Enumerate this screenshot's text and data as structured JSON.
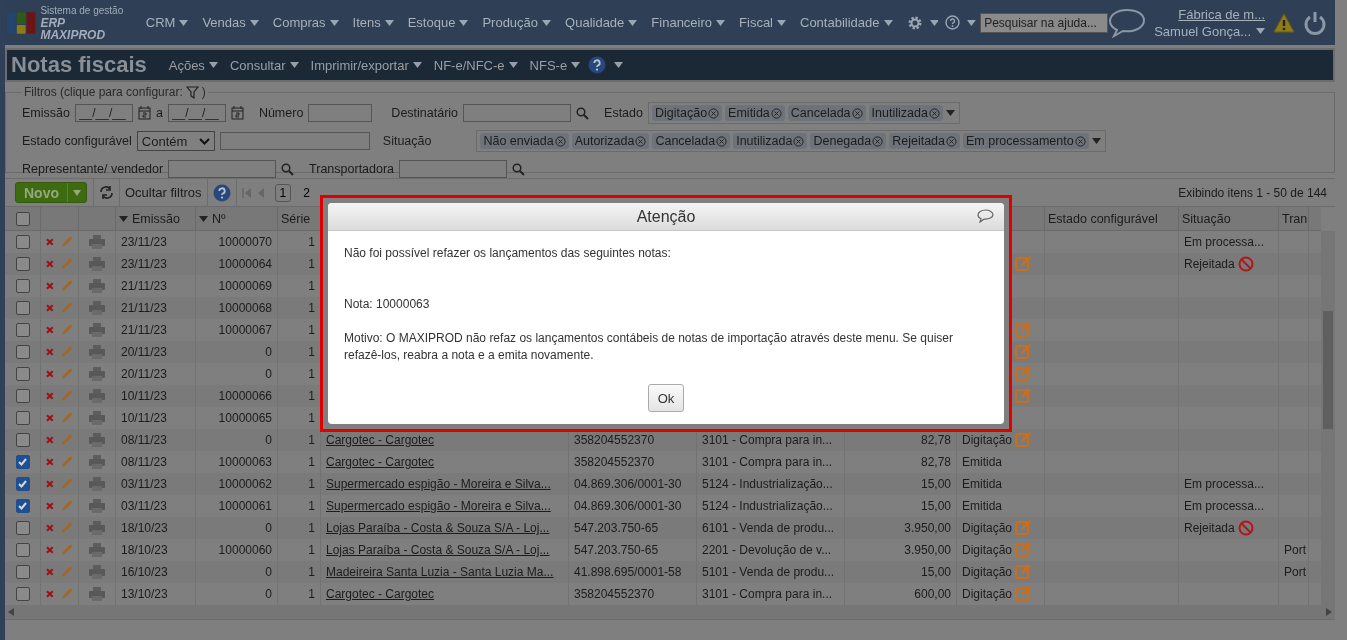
{
  "header": {
    "logo_line1": "Sistema de gestão",
    "logo_line2": "ERP MAXIPROD",
    "menu": [
      "CRM",
      "Vendas",
      "Compras",
      "Itens",
      "Estoque",
      "Produção",
      "Qualidade",
      "Financeiro",
      "Fiscal",
      "Contabilidade"
    ],
    "help_search": {
      "placeholder": "Pesquisar na ajuda..."
    },
    "company": "Fábrica de m...",
    "user": "Samuel Gonça..."
  },
  "page": {
    "title": "Notas fiscais",
    "menu": [
      "Ações",
      "Consultar",
      "Imprimir/exportar",
      "NF-e/NFC-e",
      "NFS-e"
    ]
  },
  "filters": {
    "legend": "Filtros (clique para configurar:",
    "legend_end": ")",
    "emissao_label": "Emissão",
    "date_from": "__/__/__",
    "date_sep": "a",
    "date_to": "__/__/__",
    "numero_label": "Número",
    "destinatario_label": "Destinatário",
    "estado_label": "Estado",
    "estado_chips": [
      "Digitação",
      "Emitida",
      "Cancelada",
      "Inutilizada"
    ],
    "estado_config_label": "Estado configurável",
    "estado_config_op": "Contém",
    "situacao_label": "Situação",
    "situacao_chips": [
      "Não enviada",
      "Autorizada",
      "Cancelada",
      "Inutilizada",
      "Denegada",
      "Rejeitada",
      "Em processamento"
    ],
    "representante_label": "Representante/ vendedor",
    "transportadora_label": "Transportadora"
  },
  "toolbar": {
    "new_button": "Novo",
    "hide_filters": "Ocultar filtros",
    "pages": [
      {
        "label": "1",
        "selected": true
      },
      {
        "label": "2",
        "selected": false
      }
    ],
    "summary": "Exibindo itens 1 - 50 de 144"
  },
  "table": {
    "select_all_checked": false,
    "columns": [
      {
        "label": "Emissão",
        "sorted": true
      },
      {
        "label": "Nº",
        "sorted": true
      },
      {
        "label": "Série",
        "sorted": false
      },
      {
        "label": "Estado configurável",
        "sorted": false
      },
      {
        "label": "Situação",
        "sorted": false
      },
      {
        "label": "Tran",
        "sorted": false
      }
    ],
    "rows": [
      {
        "checked": false,
        "emissao": "23/11/23",
        "numero": "10000070",
        "serie": "1",
        "estado_editable": false,
        "situacao": "Em processa...",
        "situacao_rejected": false
      },
      {
        "checked": false,
        "emissao": "23/11/23",
        "numero": "10000064",
        "serie": "1",
        "estado_editable": true,
        "situacao": "Rejeitada",
        "situacao_rejected": true
      },
      {
        "checked": false,
        "emissao": "21/11/23",
        "numero": "10000069",
        "serie": "1",
        "estado_editable": false,
        "situacao_rejected": false
      },
      {
        "checked": false,
        "emissao": "21/11/23",
        "numero": "10000068",
        "serie": "1",
        "estado_editable": false,
        "situacao_rejected": false
      },
      {
        "checked": false,
        "emissao": "21/11/23",
        "numero": "10000067",
        "serie": "1",
        "estado_editable": true,
        "situacao_rejected": false
      },
      {
        "checked": false,
        "emissao": "20/11/23",
        "numero": "0",
        "serie": "1",
        "estado_editable": true,
        "situacao_rejected": false
      },
      {
        "checked": false,
        "emissao": "20/11/23",
        "numero": "0",
        "serie": "1",
        "estado_editable": true,
        "situacao_rejected": false
      },
      {
        "checked": false,
        "emissao": "10/11/23",
        "numero": "10000066",
        "serie": "1",
        "estado_editable": true,
        "situacao_rejected": false
      },
      {
        "checked": false,
        "emissao": "10/11/23",
        "numero": "10000065",
        "serie": "1",
        "estado_editable": false,
        "situacao_rejected": false
      },
      {
        "checked": false,
        "emissao": "08/11/23",
        "numero": "0",
        "serie": "1",
        "destinatario": "Cargotec - Cargotec",
        "cnpj": "358204552370",
        "cfop": "3101 - Compra para in...",
        "valor": "82,78",
        "estado": "Digitação",
        "estado_editable": true,
        "situacao_rejected": false
      },
      {
        "checked": true,
        "emissao": "08/11/23",
        "numero": "10000063",
        "serie": "1",
        "destinatario": "Cargotec - Cargotec",
        "cnpj": "358204552370",
        "cfop": "3101 - Compra para in...",
        "valor": "82,78",
        "estado": "Emitida",
        "estado_editable": false,
        "situacao_rejected": false
      },
      {
        "checked": true,
        "emissao": "03/11/23",
        "numero": "10000062",
        "serie": "1",
        "destinatario": "Supermercado espigão - Moreira e Silva...",
        "cnpj": "04.869.306/0001-30",
        "cfop": "5124 - Industrialização...",
        "valor": "15,00",
        "estado": "Emitida",
        "estado_editable": false,
        "situacao": "Em processa...",
        "situacao_rejected": false
      },
      {
        "checked": true,
        "emissao": "03/11/23",
        "numero": "10000061",
        "serie": "1",
        "destinatario": "Supermercado espigão - Moreira e Silva...",
        "cnpj": "04.869.306/0001-30",
        "cfop": "5124 - Industrialização...",
        "valor": "15,00",
        "estado": "Emitida",
        "estado_editable": false,
        "situacao": "Em processa...",
        "situacao_rejected": false
      },
      {
        "checked": false,
        "emissao": "18/10/23",
        "numero": "0",
        "serie": "1",
        "destinatario": "Lojas Paraíba - Costa & Souza S/A - Loj...",
        "cnpj": "547.203.750-65",
        "cfop": "6101 - Venda de produ...",
        "valor": "3.950,00",
        "estado": "Digitação",
        "estado_editable": true,
        "situacao": "Rejeitada",
        "situacao_rejected": true
      },
      {
        "checked": false,
        "emissao": "18/10/23",
        "numero": "10000060",
        "serie": "1",
        "destinatario": "Lojas Paraíba - Costa & Souza S/A - Loj...",
        "cnpj": "547.203.750-65",
        "cfop": "2201 - Devolução de v...",
        "valor": "3.950,00",
        "estado": "Digitação",
        "estado_editable": true,
        "situacao_rejected": false,
        "column_14": "Port"
      },
      {
        "checked": false,
        "emissao": "16/10/23",
        "numero": "0",
        "serie": "1",
        "destinatario": "Madeireira Santa Luzia - Santa Luzia Ma...",
        "cnpj": "41.898.695/0001-58",
        "cfop": "5101 - Venda de produ...",
        "valor": "15,00",
        "estado": "Digitação",
        "estado_editable": true,
        "situacao_rejected": false,
        "column_14": "Port"
      },
      {
        "checked": false,
        "emissao": "13/10/23",
        "numero": "0",
        "serie": "1",
        "destinatario": "Cargotec - Cargotec",
        "cnpj": "358204552370",
        "cfop": "3101 - Compra para in...",
        "valor": "600,00",
        "estado": "Digitação",
        "estado_editable": true,
        "situacao_rejected": false
      }
    ]
  },
  "dialog": {
    "title": "Atenção",
    "message": "Não foi possível refazer os lançamentos das seguintes notas:",
    "note": "Nota: 10000063",
    "reason": "Motivo: O MAXIPROD não refaz os lançamentos contábeis de notas de importação através deste menu. Se quiser refazê-los, reabra a nota e a emita novamente.",
    "button": "Ok"
  }
}
